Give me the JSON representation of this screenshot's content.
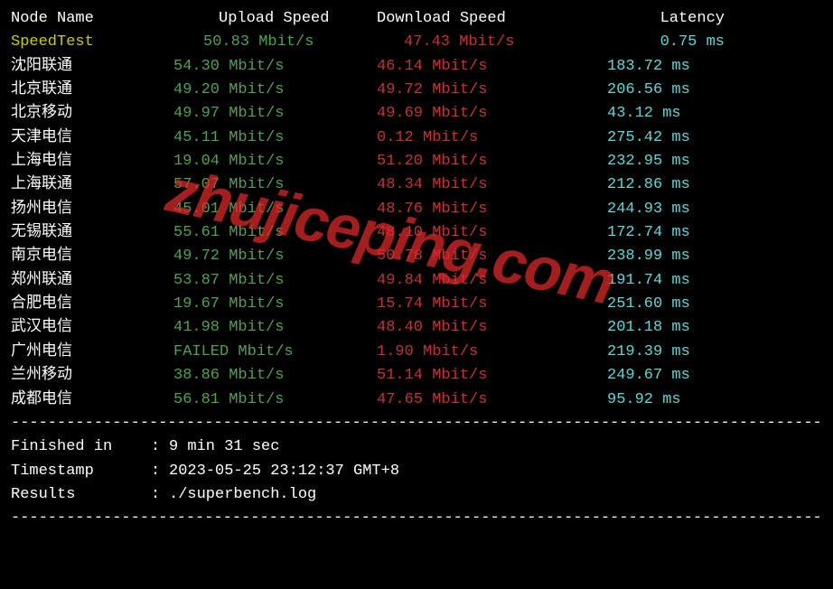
{
  "headers": {
    "node_name": "Node Name",
    "upload": "Upload Speed",
    "download": "Download Speed",
    "latency": "Latency"
  },
  "speedtest_row": {
    "name": "SpeedTest",
    "upload": "50.83 Mbit/s",
    "download": "47.43 Mbit/s",
    "latency": "0.75 ms"
  },
  "rows": [
    {
      "name": "沈阳联通",
      "upload": "54.30 Mbit/s",
      "download": "46.14 Mbit/s",
      "latency": "183.72 ms"
    },
    {
      "name": "北京联通",
      "upload": "49.20 Mbit/s",
      "download": "49.72 Mbit/s",
      "latency": "206.56 ms"
    },
    {
      "name": "北京移动",
      "upload": "49.97 Mbit/s",
      "download": "49.69 Mbit/s",
      "latency": "43.12 ms"
    },
    {
      "name": "天津电信",
      "upload": "45.11 Mbit/s",
      "download": "0.12 Mbit/s",
      "latency": "275.42 ms"
    },
    {
      "name": "上海电信",
      "upload": "19.04 Mbit/s",
      "download": "51.20 Mbit/s",
      "latency": "232.95 ms"
    },
    {
      "name": "上海联通",
      "upload": "57.07 Mbit/s",
      "download": "48.34 Mbit/s",
      "latency": "212.86 ms"
    },
    {
      "name": "扬州电信",
      "upload": "45.01 Mbit/s",
      "download": "48.76 Mbit/s",
      "latency": "244.93 ms"
    },
    {
      "name": "无锡联通",
      "upload": "55.61 Mbit/s",
      "download": "48.10 Mbit/s",
      "latency": "172.74 ms"
    },
    {
      "name": "南京电信",
      "upload": "49.72 Mbit/s",
      "download": "50.78 Mbit/s",
      "latency": "238.99 ms"
    },
    {
      "name": "郑州联通",
      "upload": "53.87 Mbit/s",
      "download": "49.84 Mbit/s",
      "latency": "191.74 ms"
    },
    {
      "name": "合肥电信",
      "upload": "19.67 Mbit/s",
      "download": "15.74 Mbit/s",
      "latency": "251.60 ms"
    },
    {
      "name": "武汉电信",
      "upload": "41.98 Mbit/s",
      "download": "48.40 Mbit/s",
      "latency": "201.18 ms"
    },
    {
      "name": "广州电信",
      "upload": "FAILED Mbit/s",
      "download": "1.90 Mbit/s",
      "latency": "219.39 ms"
    },
    {
      "name": "兰州移动",
      "upload": "38.86 Mbit/s",
      "download": "51.14 Mbit/s",
      "latency": "249.67 ms"
    },
    {
      "name": "成都电信",
      "upload": "56.81 Mbit/s",
      "download": "47.65 Mbit/s",
      "latency": "95.92 ms"
    }
  ],
  "divider": "----------------------------------------------------------------------------------------",
  "footer": {
    "finished_label": "Finished in",
    "finished_value": "9 min 31 sec",
    "timestamp_label": "Timestamp",
    "timestamp_value": "2023-05-25 23:12:37 GMT+8",
    "results_label": "Results",
    "results_value": "./superbench.log",
    "colon": ":"
  },
  "watermark": "zhujiceping.com"
}
